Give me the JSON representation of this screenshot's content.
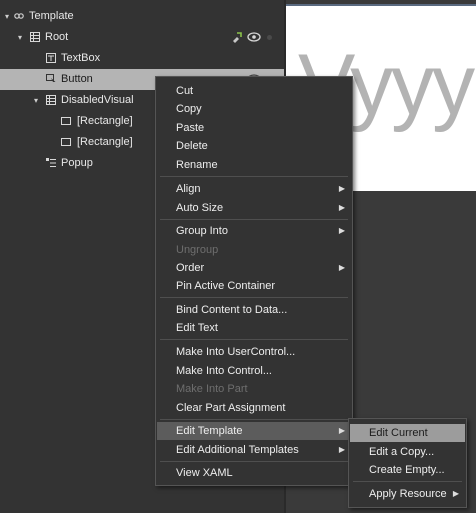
{
  "tree": {
    "items": [
      {
        "label": "Template"
      },
      {
        "label": "Root"
      },
      {
        "label": "TextBox"
      },
      {
        "label": "Button"
      },
      {
        "label": "DisabledVisual"
      },
      {
        "label": "[Rectangle]"
      },
      {
        "label": "[Rectangle]"
      },
      {
        "label": "Popup"
      }
    ]
  },
  "artboard": {
    "text": "Vyyy"
  },
  "context_menu": {
    "items": [
      {
        "label": "Cut"
      },
      {
        "label": "Copy"
      },
      {
        "label": "Paste"
      },
      {
        "label": "Delete"
      },
      {
        "label": "Rename"
      },
      {
        "label": "Align"
      },
      {
        "label": "Auto Size"
      },
      {
        "label": "Group Into"
      },
      {
        "label": "Ungroup"
      },
      {
        "label": "Order"
      },
      {
        "label": "Pin Active Container"
      },
      {
        "label": "Bind Content to Data..."
      },
      {
        "label": "Edit Text"
      },
      {
        "label": "Make Into UserControl..."
      },
      {
        "label": "Make Into Control..."
      },
      {
        "label": "Make Into Part"
      },
      {
        "label": "Clear Part Assignment"
      },
      {
        "label": "Edit Template"
      },
      {
        "label": "Edit Additional Templates"
      },
      {
        "label": "View XAML"
      }
    ]
  },
  "submenu": {
    "items": [
      {
        "label": "Edit Current"
      },
      {
        "label": "Edit a Copy..."
      },
      {
        "label": "Create Empty..."
      },
      {
        "label": "Apply Resource"
      }
    ]
  }
}
